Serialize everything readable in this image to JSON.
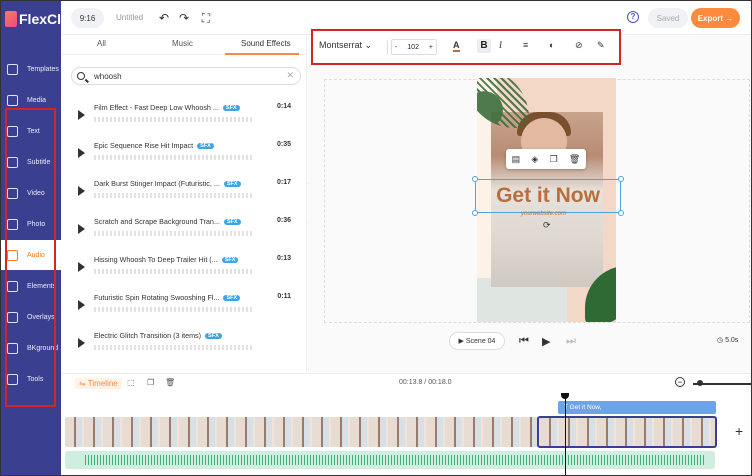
{
  "app": {
    "name": "FlexClip"
  },
  "sidebar": {
    "items": [
      {
        "label": "Templates",
        "icon": "templates-icon"
      },
      {
        "label": "Media",
        "icon": "media-icon"
      },
      {
        "label": "Text",
        "icon": "text-icon"
      },
      {
        "label": "Subtitle",
        "icon": "subtitle-icon"
      },
      {
        "label": "Video",
        "icon": "video-icon"
      },
      {
        "label": "Photo",
        "icon": "photo-icon"
      },
      {
        "label": "Audio",
        "icon": "audio-icon",
        "active": true
      },
      {
        "label": "Elements",
        "icon": "elements-icon"
      },
      {
        "label": "Overlays",
        "icon": "overlays-icon"
      },
      {
        "label": "BKground",
        "icon": "background-icon"
      },
      {
        "label": "Tools",
        "icon": "tools-icon"
      }
    ]
  },
  "topbar": {
    "ratio": "9:16",
    "title": "Untitled",
    "saved": "Saved",
    "export": "Export →",
    "help": "?"
  },
  "panel": {
    "tabs": [
      "All",
      "Music",
      "Sound Effects"
    ],
    "active_tab": "Sound Effects",
    "search_value": "whoosh",
    "tracks": [
      {
        "name": "Film Effect - Fast Deep Low Whoosh ...",
        "badge": "SFX",
        "duration": "0:14"
      },
      {
        "name": "Epic Sequence Rise Hit Impact",
        "badge": "SFX",
        "duration": "0:35"
      },
      {
        "name": "Dark Burst Stinger Impact (Futuristic, ...",
        "badge": "SFX",
        "duration": "0:17"
      },
      {
        "name": "Scratch and Scrape Background Tran...",
        "badge": "SFX",
        "duration": "0:36"
      },
      {
        "name": "Hissing Whoosh To Deep Trailer Hit (...",
        "badge": "SFX",
        "duration": "0:13"
      },
      {
        "name": "Futuristic Spin Rotating Swooshing Fl...",
        "badge": "SFX",
        "duration": "0:11"
      },
      {
        "name": "Electric Glitch Transition (3 items)",
        "badge": "SFX",
        "duration": ""
      }
    ]
  },
  "text_toolbar": {
    "font": "Montserrat",
    "size": "102",
    "minus": "-",
    "plus": "+"
  },
  "design": {
    "headline": "Get it Now",
    "url": "yourwebsite.com"
  },
  "player": {
    "scene": "Scene 04",
    "total": "5.0s"
  },
  "timeline": {
    "label": "Timeline",
    "time": "00:13.8 / 00:18.0",
    "text_clip": "T  Get it Now,"
  },
  "colors": {
    "sidebar": "#3a3f8f",
    "accent": "#ff8a3d",
    "highlight": "#d32525"
  }
}
